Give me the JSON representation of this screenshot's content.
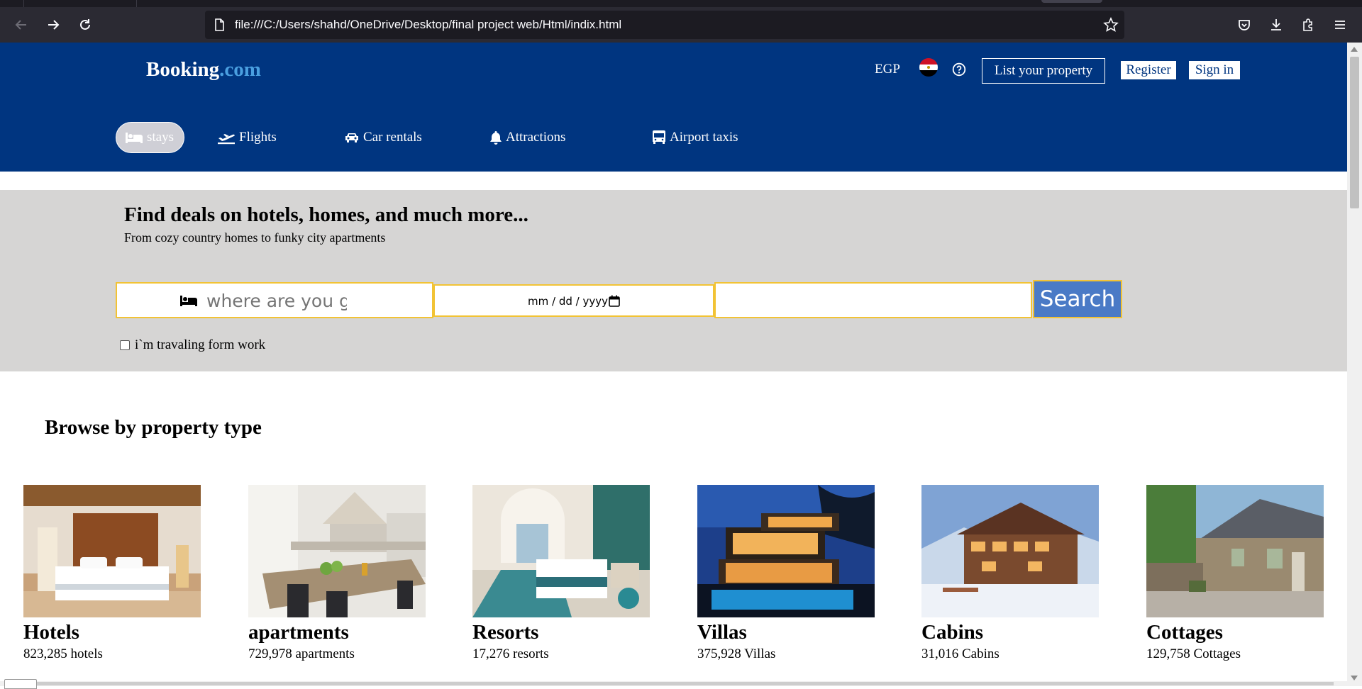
{
  "browser": {
    "url": "file:///C:/Users/shahd/OneDrive/Desktop/final project web/Html/indix.html"
  },
  "header": {
    "logo_main": "Booking",
    "logo_suffix": ".com",
    "currency": "EGP",
    "list_property": "List your property",
    "register": "Register",
    "sign_in": "Sign in"
  },
  "nav": {
    "items": [
      {
        "label": "stays",
        "icon": "bed-icon",
        "active": true
      },
      {
        "label": "Flights",
        "icon": "plane-icon"
      },
      {
        "label": "Car rentals",
        "icon": "car-icon"
      },
      {
        "label": "Attractions",
        "icon": "bell-icon"
      },
      {
        "label": "Airport taxis",
        "icon": "bus-icon"
      }
    ]
  },
  "search": {
    "title": "Find deals on hotels, homes, and much more...",
    "subtitle": "From cozy country homes to funky city apartments",
    "destination_placeholder": "where are you going?",
    "date_placeholder": "mm / dd / yyyy",
    "guests_value": "",
    "button": "Search",
    "work_label": "i`m travaling form work"
  },
  "browse": {
    "title": "Browse by property type",
    "cards": [
      {
        "name": "Hotels",
        "count": "823,285 hotels"
      },
      {
        "name": "apartments",
        "count": "729,978 apartments"
      },
      {
        "name": "Resorts",
        "count": "17,276 resorts"
      },
      {
        "name": "Villas",
        "count": "375,928 Villas"
      },
      {
        "name": "Cabins",
        "count": "31,016 Cabins"
      },
      {
        "name": "Cottages",
        "count": "129,758 Cottages"
      }
    ]
  },
  "colors": {
    "header_bg": "#003580",
    "search_bg": "#d6d5d4",
    "accent_border": "#f2c335",
    "search_button": "#4a7ac6"
  }
}
